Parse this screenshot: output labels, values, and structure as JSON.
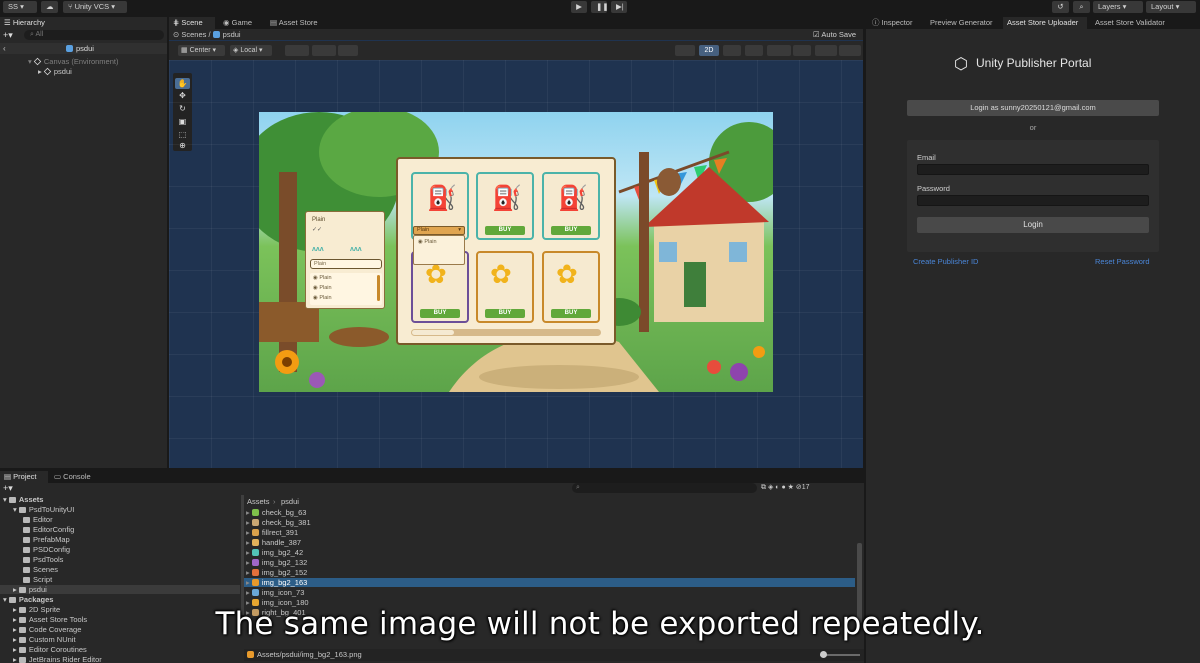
{
  "topbar": {
    "account": "SS",
    "vcs": "Unity VCS",
    "layers": "Layers",
    "layout": "Layout"
  },
  "hierarchy": {
    "tab": "Hierarchy",
    "search_placeholder": "All",
    "scene_name": "psdui",
    "items": [
      {
        "label": "Canvas (Environment)"
      },
      {
        "label": "psdui"
      }
    ]
  },
  "scene": {
    "tabs": [
      "Scene",
      "Game",
      "Asset Store"
    ],
    "breadcrumb": [
      "Scenes",
      "psdui"
    ],
    "autosave": "Auto Save",
    "pivot": "Center",
    "space": "Local",
    "mode_2d": "2D"
  },
  "game_ui": {
    "panel_label": "Plain",
    "dropdown_value": "Plain",
    "dropdown_option": "Plain",
    "input_value": "Plain",
    "options": [
      "Plain",
      "Plain",
      "Plain"
    ],
    "buy_label": "BUY"
  },
  "inspector": {
    "tabs": [
      "Inspector",
      "Preview Generator",
      "Asset Store Uploader",
      "Asset Store Validator"
    ],
    "portal_title": "Unity Publisher Portal",
    "login_as": "Login as sunny20250121@gmail.com",
    "or": "or",
    "email_label": "Email",
    "password_label": "Password",
    "login_button": "Login",
    "create_id": "Create Publisher ID",
    "reset_password": "Reset Password"
  },
  "project": {
    "tabs": [
      "Project",
      "Console"
    ],
    "count": "17",
    "tree": [
      {
        "label": "Assets",
        "level": 0
      },
      {
        "label": "PsdToUnityUI",
        "level": 1
      },
      {
        "label": "Editor",
        "level": 2
      },
      {
        "label": "EditorConfig",
        "level": 2
      },
      {
        "label": "PrefabMap",
        "level": 2
      },
      {
        "label": "PSDConfig",
        "level": 2
      },
      {
        "label": "PsdTools",
        "level": 2
      },
      {
        "label": "Scenes",
        "level": 2
      },
      {
        "label": "Script",
        "level": 2
      },
      {
        "label": "psdui",
        "level": 1
      },
      {
        "label": "Packages",
        "level": 0
      },
      {
        "label": "2D Sprite",
        "level": 1
      },
      {
        "label": "Asset Store Tools",
        "level": 1
      },
      {
        "label": "Code Coverage",
        "level": 1
      },
      {
        "label": "Custom NUnit",
        "level": 1
      },
      {
        "label": "Editor Coroutines",
        "level": 1
      },
      {
        "label": "JetBrains Rider Editor",
        "level": 1
      }
    ],
    "breadcrumb": [
      "Assets",
      "psdui"
    ],
    "files": [
      {
        "label": "check_bg_63",
        "color": "#7ec04a"
      },
      {
        "label": "check_bg_381",
        "color": "#c9a774"
      },
      {
        "label": "fillrect_391",
        "color": "#d9a14b"
      },
      {
        "label": "handle_387",
        "color": "#e2b25a"
      },
      {
        "label": "img_bg2_42",
        "color": "#52c3b7"
      },
      {
        "label": "img_bg2_132",
        "color": "#a066c9"
      },
      {
        "label": "img_bg2_152",
        "color": "#e2703c"
      },
      {
        "label": "img_bg2_163",
        "color": "#e89a2c"
      },
      {
        "label": "img_icon_73",
        "color": "#6aa7d6"
      },
      {
        "label": "img_icon_180",
        "color": "#e7a630"
      },
      {
        "label": "right_bg_401",
        "color": "#c39b62"
      }
    ],
    "selected_index": 7,
    "status_path": "Assets/psdui/img_bg2_163.png"
  },
  "subtitle": "The same image will not be exported repeatedly."
}
